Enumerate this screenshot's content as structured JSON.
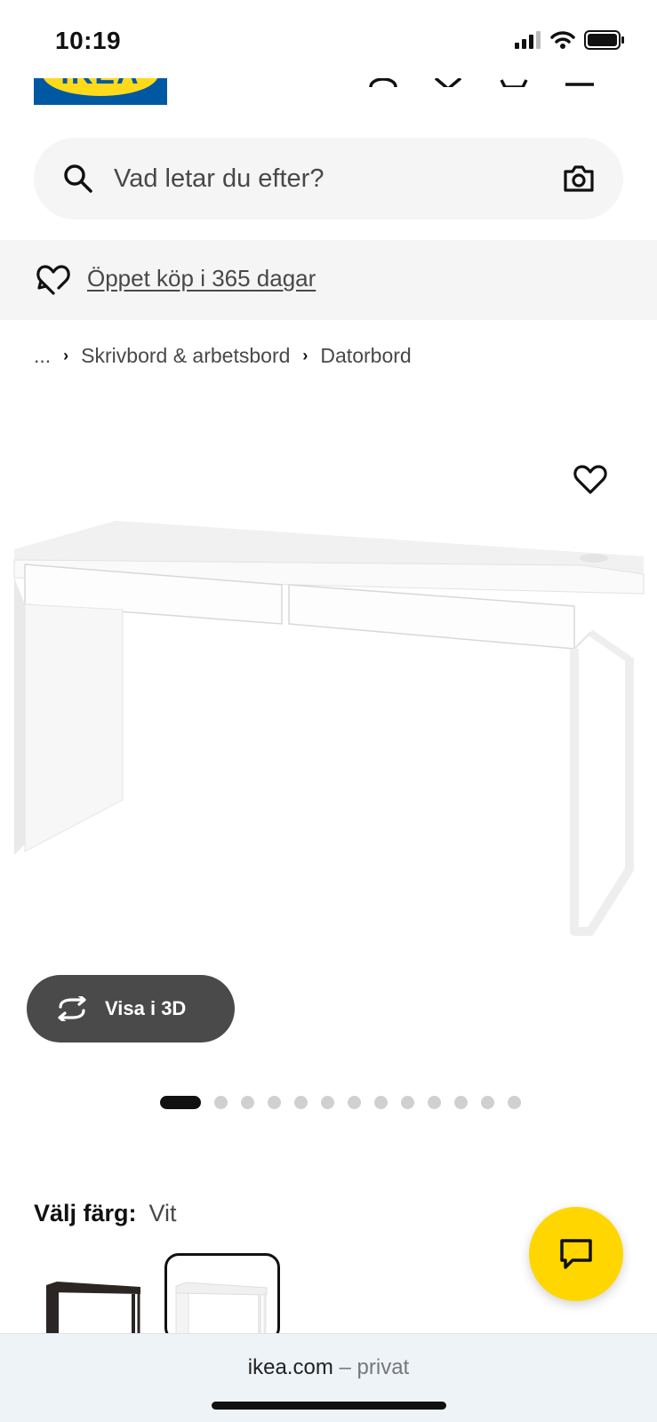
{
  "status_bar": {
    "time": "10:19"
  },
  "header": {
    "logo_text": "IKEA",
    "icons": [
      "person-icon",
      "chevron-down-icon",
      "cart-icon",
      "menu-icon"
    ]
  },
  "search": {
    "placeholder": "Vad letar du efter?"
  },
  "promo": {
    "text": "Öppet köp i 365 dagar"
  },
  "breadcrumb": {
    "items": [
      "...",
      "Skrivbord & arbetsbord",
      "Datorbord"
    ]
  },
  "product": {
    "view_3d_label": "Visa i 3D",
    "image_count": 13,
    "active_image": 1
  },
  "color_picker": {
    "label": "Välj färg:",
    "selected": "Vit"
  },
  "browser": {
    "domain": "ikea.com",
    "mode": "– privat"
  },
  "colors": {
    "brand_blue": "#0058a3",
    "brand_yellow": "#ffda1a",
    "chat_yellow": "#ffd600",
    "button_dark": "#4a4a4a"
  }
}
